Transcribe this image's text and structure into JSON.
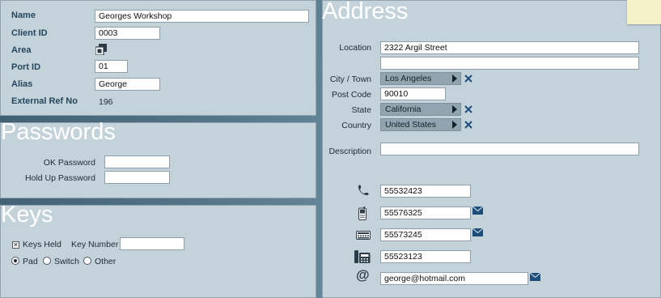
{
  "client": {
    "name_label": "Name",
    "name_value": "Georges Workshop",
    "client_id_label": "Client ID",
    "client_id_value": "0003",
    "area_label": "Area",
    "port_id_label": "Port ID",
    "port_id_value": "01",
    "alias_label": "Alias",
    "alias_value": "George",
    "external_ref_label": "External Ref No",
    "external_ref_value": "196"
  },
  "passwords": {
    "heading": "Passwords",
    "ok_label": "OK Password",
    "ok_value": "",
    "holdup_label": "Hold Up Password",
    "holdup_value": ""
  },
  "keys": {
    "heading": "Keys",
    "keys_held_label": "Keys Held",
    "keys_held_checked": true,
    "key_number_label": "Key Number",
    "key_number_value": "",
    "options": [
      "Pad",
      "Switch",
      "Other"
    ],
    "selected": "Pad"
  },
  "address": {
    "heading": "Address",
    "location_label": "Location",
    "location_line1": "2322 Argil Street",
    "location_line2": "",
    "city_label": "City / Town",
    "city_value": "Los Angeles",
    "postcode_label": "Post Code",
    "postcode_value": "90010",
    "state_label": "State",
    "state_value": "California",
    "country_label": "Country",
    "country_value": "United States",
    "description_label": "Description",
    "description_value": ""
  },
  "contacts": {
    "phone": "55532423",
    "mobile": "55576325",
    "fax": "55573245",
    "desk_phone": "55523123",
    "email": "george@hotmail.com",
    "email_symbol": "@"
  },
  "colors": {
    "panel": "#c4d3da",
    "label_blue": "#24465f",
    "combo": "#91a4af",
    "clear_x": "#1e4d7a",
    "sticky_note": "#f4f0c8"
  }
}
